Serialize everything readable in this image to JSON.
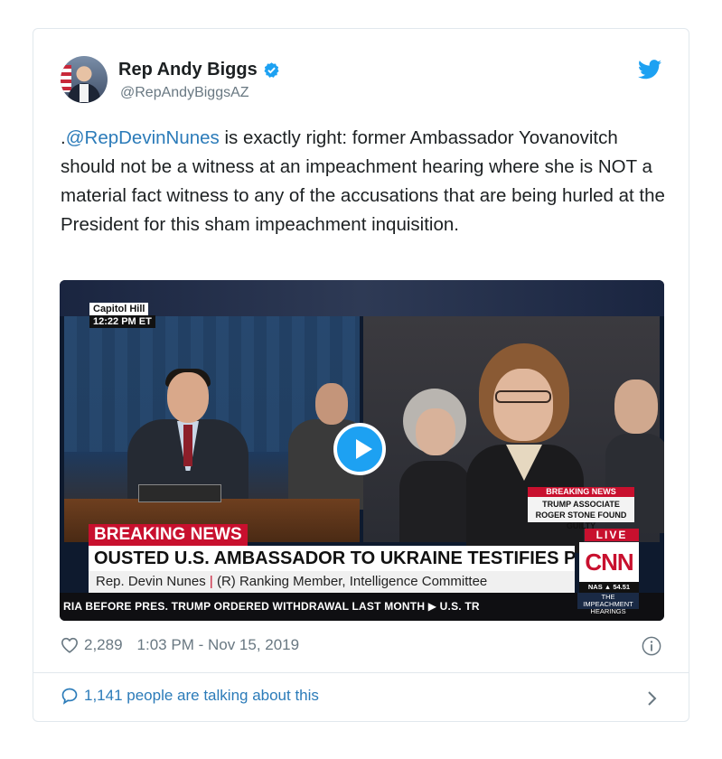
{
  "tweet": {
    "author_name": "Rep Andy Biggs",
    "handle": "@RepAndyBiggsAZ",
    "text_prefix": ".",
    "mention": "@RepDevinNunes",
    "text_rest": " is exactly right: former Ambassador Yovanovitch should not be a witness at an impeachment hearing where she is NOT a material fact witness to any of the accusations that are being hurled at the President for this sham impeachment inquisition.",
    "likes": "2,289",
    "timestamp": "1:03 PM - Nov 15, 2019",
    "talking_about": "1,141 people are talking about this"
  },
  "video": {
    "location": "Capitol Hill",
    "time": "12:22 PM ET",
    "breaking_news_label": "BREAKING NEWS",
    "headline": "OUSTED U.S. AMBASSADOR TO UKRAINE TESTIFIES PUBLICLY",
    "subline_name": "Rep. Devin Nunes",
    "subline_sep": "|",
    "subline_role": " (R) Ranking Member, Intelligence Committee",
    "side_breaking_label": "BREAKING NEWS",
    "side_breaking_text": "TRUMP ASSOCIATE ROGER STONE FOUND GUILTY",
    "live": "LIVE",
    "network": "CNN",
    "nas": "NAS ▲ 54.51",
    "ticker": "RIA BEFORE PRES. TRUMP ORDERED WITHDRAWAL LAST MONTH   ▶  U.S. TR",
    "impeach_label": "THE IMPEACHMENT HEARINGS",
    "nameplate": "MR. NUNES"
  },
  "icons": {
    "verified": "verified-badge-icon",
    "bird": "twitter-bird-icon",
    "heart": "heart-icon",
    "info": "info-icon",
    "bubble": "speech-bubble-icon",
    "play": "play-icon",
    "chevron": "chevron-right-icon"
  },
  "colors": {
    "link": "#2b7bb9",
    "twitter_blue": "#1da1f2",
    "cnn_red": "#c8102e",
    "muted": "#697882"
  }
}
